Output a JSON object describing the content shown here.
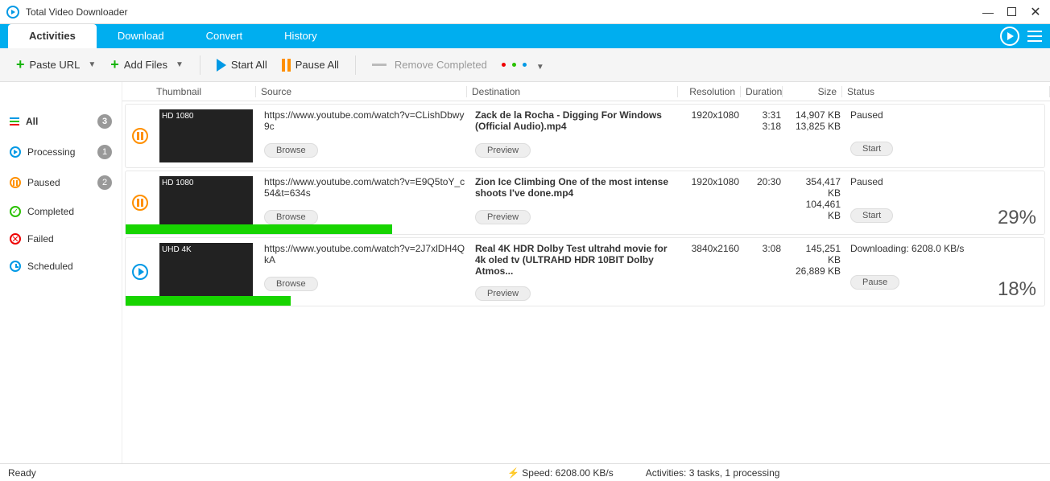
{
  "app": {
    "title": "Total Video Downloader"
  },
  "tabs": {
    "activities": "Activities",
    "download": "Download",
    "convert": "Convert",
    "history": "History"
  },
  "toolbar": {
    "paste_url": "Paste URL",
    "add_files": "Add Files",
    "start_all": "Start All",
    "pause_all": "Pause All",
    "remove_completed": "Remove Completed"
  },
  "sidebar": {
    "all": "All",
    "all_badge": "3",
    "processing": "Processing",
    "processing_badge": "1",
    "paused": "Paused",
    "paused_badge": "2",
    "completed": "Completed",
    "failed": "Failed",
    "scheduled": "Scheduled"
  },
  "columns": {
    "thumbnail": "Thumbnail",
    "source": "Source",
    "destination": "Destination",
    "resolution": "Resolution",
    "duration": "Duration",
    "size": "Size",
    "status": "Status"
  },
  "btn": {
    "browse": "Browse",
    "preview": "Preview",
    "start": "Start",
    "pause": "Pause"
  },
  "rows": [
    {
      "thumb_label": "HD 1080",
      "url": "https://www.youtube.com/watch?v=CLishDbwy9c",
      "fname": "Zack de la Rocha - Digging For Windows (Official Audio).mp4",
      "res": "1920x1080",
      "dur1": "3:31",
      "dur2": "3:18",
      "size1": "14,907 KB",
      "size2": "13,825 KB",
      "status": "Paused",
      "progress": 0,
      "percent": "",
      "action": "start",
      "state": "paused"
    },
    {
      "thumb_label": "HD 1080",
      "url": "https://www.youtube.com/watch?v=E9Q5toY_c54&t=634s",
      "fname": "Zion Ice Climbing One of the most intense shoots I've done.mp4",
      "res": "1920x1080",
      "dur1": "20:30",
      "dur2": "",
      "size1": "354,417 KB",
      "size2": "104,461 KB",
      "status": "Paused",
      "progress": 29,
      "percent": "29%",
      "action": "start",
      "state": "paused"
    },
    {
      "thumb_label": "UHD 4K",
      "url": "https://www.youtube.com/watch?v=2J7xlDH4QkA",
      "fname": "Real 4K HDR Dolby Test ultrahd movie for 4k oled tv (ULTRAHD HDR 10BIT Dolby Atmos...",
      "res": "3840x2160",
      "dur1": "3:08",
      "dur2": "",
      "size1": "145,251 KB",
      "size2": "26,889 KB",
      "status": "Downloading: 6208.0 KB/s",
      "progress": 18,
      "percent": "18%",
      "action": "pause",
      "state": "playing"
    }
  ],
  "status": {
    "ready": "Ready",
    "speed": "Speed: 6208.00 KB/s",
    "acts": "Activities: 3 tasks, 1 processing"
  }
}
